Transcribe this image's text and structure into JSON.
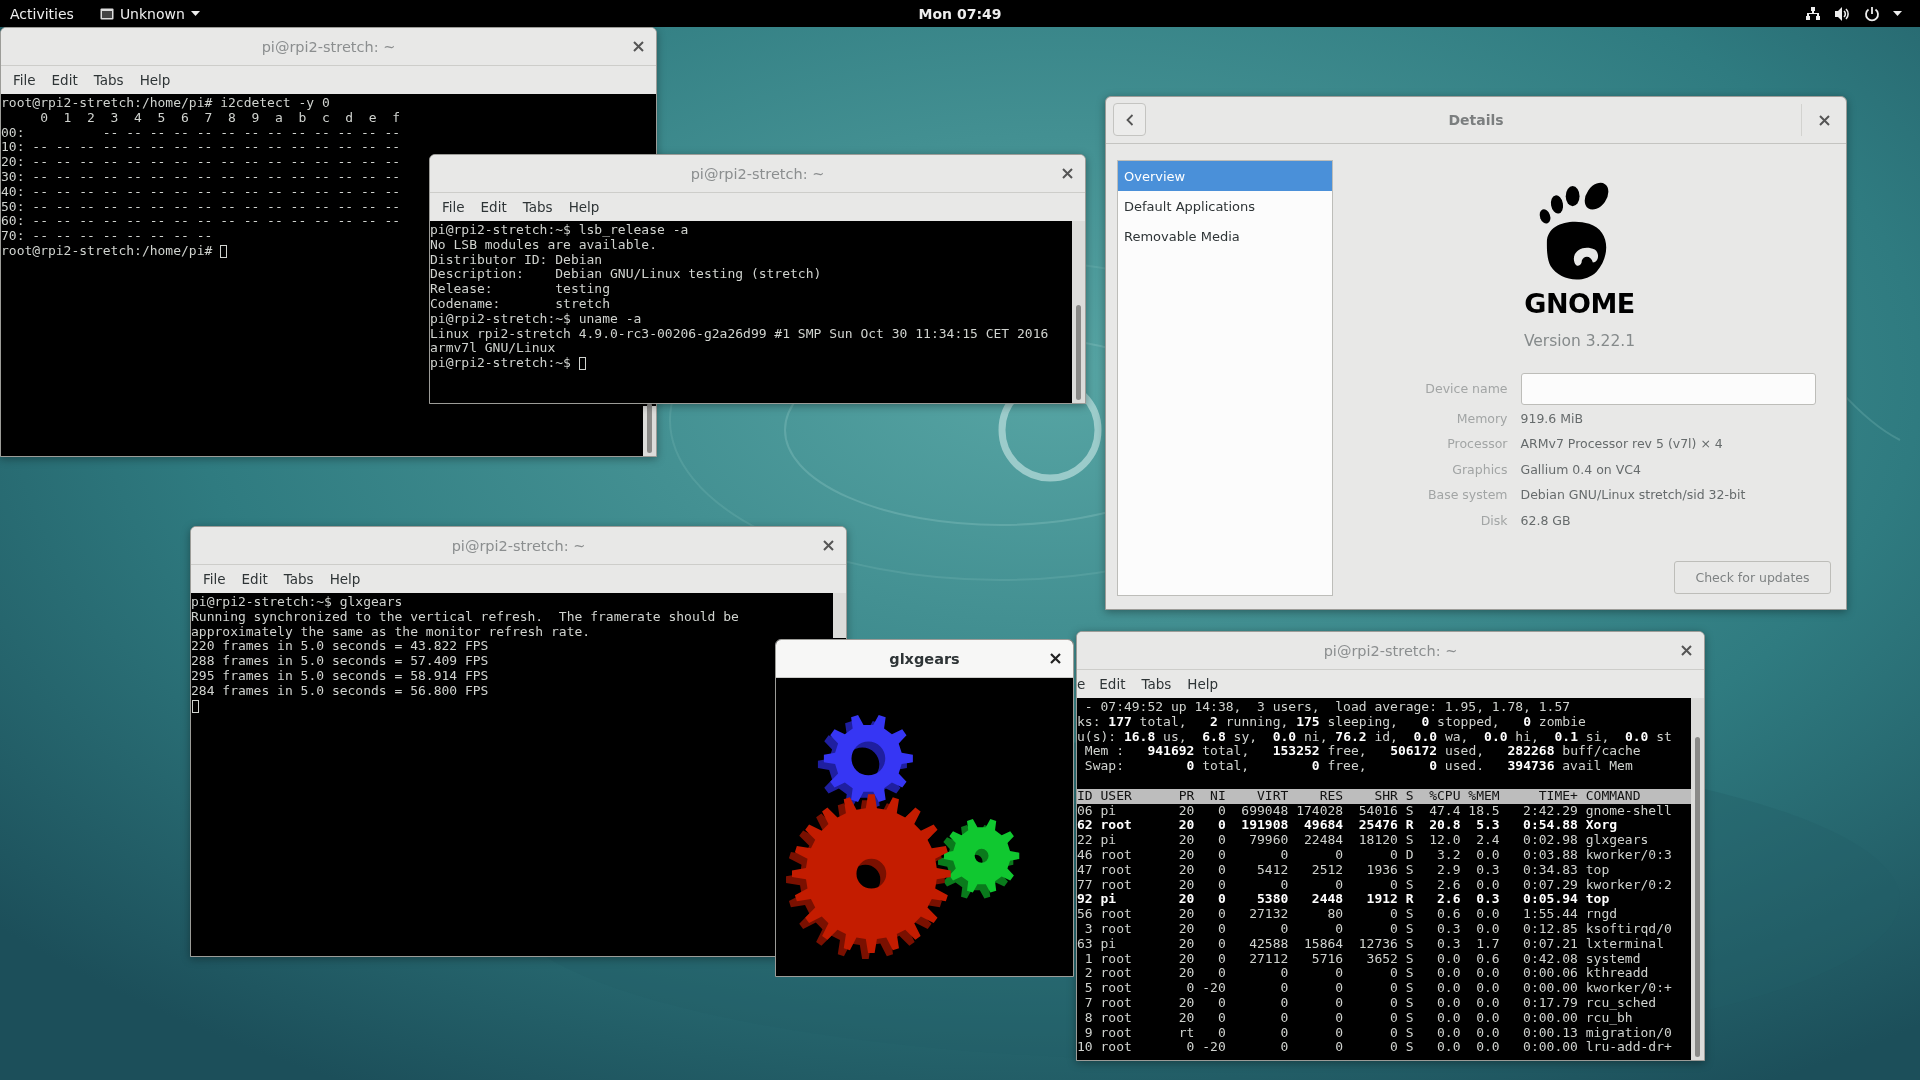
{
  "top_bar": {
    "activities": "Activities",
    "app_menu": "Unknown",
    "clock": "Mon 07:49"
  },
  "terminals": [
    {
      "title": "pi@rpi2-stretch: ~",
      "menus": [
        "File",
        "Edit",
        "Tabs",
        "Help"
      ],
      "lines": [
        {
          "text": "root@rpi2-stretch:/home/pi# i2cdetect -y 0"
        },
        {
          "text": "     0  1  2  3  4  5  6  7  8  9  a  b  c  d  e  f"
        },
        {
          "text": "00:          -- -- -- -- -- -- -- -- -- -- -- -- --"
        },
        {
          "text": "10: -- -- -- -- -- -- -- -- -- -- -- -- -- -- -- --"
        },
        {
          "text": "20: -- -- -- -- -- -- -- -- -- -- -- -- -- -- -- --"
        },
        {
          "text": "30: -- -- -- -- -- -- -- -- -- -- -- -- -- -- -- --"
        },
        {
          "text": "40: -- -- -- -- -- -- -- -- -- -- -- -- -- -- -- --"
        },
        {
          "text": "50: -- -- -- -- -- -- -- -- -- -- -- -- -- -- -- --"
        },
        {
          "text": "60: -- -- -- -- -- -- -- -- -- -- -- -- -- -- -- --"
        },
        {
          "text": "70: -- -- -- -- -- -- -- --"
        },
        {
          "text": "root@rpi2-stretch:/home/pi#",
          "cursor": true
        }
      ]
    },
    {
      "title": "pi@rpi2-stretch: ~",
      "menus": [
        "File",
        "Edit",
        "Tabs",
        "Help"
      ],
      "lines": [
        {
          "text": "pi@rpi2-stretch:~$ lsb_release -a"
        },
        {
          "text": "No LSB modules are available."
        },
        {
          "text": "Distributor ID: Debian"
        },
        {
          "text": "Description:    Debian GNU/Linux testing (stretch)"
        },
        {
          "text": "Release:        testing"
        },
        {
          "text": "Codename:       stretch"
        },
        {
          "text": "pi@rpi2-stretch:~$ uname -a"
        },
        {
          "text": "Linux rpi2-stretch 4.9.0-rc3-00206-g2a26d99 #1 SMP Sun Oct 30 11:34:15 CET 2016"
        },
        {
          "text": "armv7l GNU/Linux"
        },
        {
          "text": "pi@rpi2-stretch:~$",
          "cursor": true
        }
      ]
    },
    {
      "title": "pi@rpi2-stretch: ~",
      "menus": [
        "File",
        "Edit",
        "Tabs",
        "Help"
      ],
      "lines": [
        {
          "text": "pi@rpi2-stretch:~$ glxgears"
        },
        {
          "text": "Running synchronized to the vertical refresh.  The framerate should be"
        },
        {
          "text": "approximately the same as the monitor refresh rate."
        },
        {
          "text": "220 frames in 5.0 seconds = 43.822 FPS"
        },
        {
          "text": "288 frames in 5.0 seconds = 57.409 FPS"
        },
        {
          "text": "295 frames in 5.0 seconds = 58.914 FPS"
        },
        {
          "text": "284 frames in 5.0 seconds = 56.800 FPS"
        },
        {
          "cursor": true
        }
      ]
    },
    {
      "title": "pi@rpi2-stretch: ~",
      "menus": [
        "e",
        "Edit",
        "Tabs",
        "Help"
      ],
      "lines": [
        {
          "text": " - 07:49:52 up 14:38,  3 users,  load average: 1.95, 1.78, 1.57",
          "bold": false
        },
        {
          "text": "ks: **177** total,   **2** running, **175** sleeping,   **0** stopped,   **0** zombie",
          "bold": false
        },
        {
          "text": "u(s): **16.8** us,  **6.8** sy,  **0.0** ni, **76.2** id,  **0.0** wa,  **0.0** hi,  **0.1** si,  **0.0** st",
          "bold": false
        },
        {
          "text": " Mem :   **941692** total,   **153252** free,   **506172** used,   **282268** buff/cache",
          "bold": false
        },
        {
          "text": " Swap:        **0** total,        **0** free,        **0** used.   **394736** avail Mem",
          "bold": false
        },
        {
          "text": "ID USER      PR  NI    VIRT    RES    SHR S  %CPU %MEM     TIME+ COMMAND",
          "kind": "header",
          "bold": false
        },
        {
          "text": "06 pi        20   0  699048 174028  54016 S  47.4 18.5   2:42.29 gnome-shell",
          "bold": false
        },
        {
          "text": "62 root      20   0  191908  49684  25476 R  20.8  5.3   0:54.88 Xorg",
          "bold": true
        },
        {
          "text": "22 pi        20   0   79960  22484  18120 S  12.0  2.4   0:02.98 glxgears",
          "bold": false
        },
        {
          "text": "46 root      20   0       0      0      0 D   3.2  0.0   0:03.88 kworker/0:3",
          "bold": false
        },
        {
          "text": "47 root      20   0    5412   2512   1936 S   2.9  0.3   0:34.83 top",
          "bold": false
        },
        {
          "text": "77 root      20   0       0      0      0 S   2.6  0.0   0:07.29 kworker/0:2",
          "bold": false
        },
        {
          "text": "92 pi        20   0    5380   2448   1912 R   2.6  0.3   0:05.94 top",
          "bold": true
        },
        {
          "text": "56 root      20   0   27132     80      0 S   0.6  0.0   1:55.44 rngd",
          "bold": false
        },
        {
          "text": " 3 root      20   0       0      0      0 S   0.3  0.0   0:12.85 ksoftirqd/0",
          "bold": false
        },
        {
          "text": "63 pi        20   0   42588  15864  12736 S   0.3  1.7   0:07.21 lxterminal",
          "bold": false
        },
        {
          "text": " 1 root      20   0   27112   5716   3652 S   0.0  0.6   0:42.08 systemd",
          "bold": false
        },
        {
          "text": " 2 root      20   0       0      0      0 S   0.0  0.0   0:00.06 kthreadd",
          "bold": false
        },
        {
          "text": " 5 root       0 -20       0      0      0 S   0.0  0.0   0:00.00 kworker/0:+",
          "bold": false
        },
        {
          "text": " 7 root      20   0       0      0      0 S   0.0  0.0   0:17.79 rcu_sched",
          "bold": false
        },
        {
          "text": " 8 root      20   0       0      0      0 S   0.0  0.0   0:00.00 rcu_bh",
          "bold": false
        },
        {
          "text": " 9 root      rt   0       0      0      0 S   0.0  0.0   0:00.13 migration/0",
          "bold": false
        },
        {
          "text": "10 root       0 -20       0      0      0 S   0.0  0.0   0:00.00 lru-add-dr+",
          "bold": false
        }
      ]
    }
  ],
  "glxgears": {
    "title": "glxgears"
  },
  "details": {
    "title": "Details",
    "sidebar": [
      {
        "label": "Overview",
        "selected": true
      },
      {
        "label": "Default Applications",
        "selected": false
      },
      {
        "label": "Removable Media",
        "selected": false
      }
    ],
    "logo_text": "GNOME",
    "version": "Version 3.22.1",
    "rows": [
      {
        "label": "Device name",
        "kind": "field"
      },
      {
        "label": "Memory",
        "kind": "text",
        "value": "919.6 MiB"
      },
      {
        "label": "Processor",
        "kind": "text",
        "value": "ARMv7 Processor rev 5 (v7l) × 4"
      },
      {
        "label": "Graphics",
        "kind": "text",
        "value": "Gallium 0.4 on VC4"
      },
      {
        "label": "Base system",
        "kind": "text",
        "value": "Debian GNU/Linux stretch/sid 32-bit"
      },
      {
        "label": "Disk",
        "kind": "text",
        "value": "62.8 GB"
      }
    ],
    "button": "Check for updates"
  }
}
